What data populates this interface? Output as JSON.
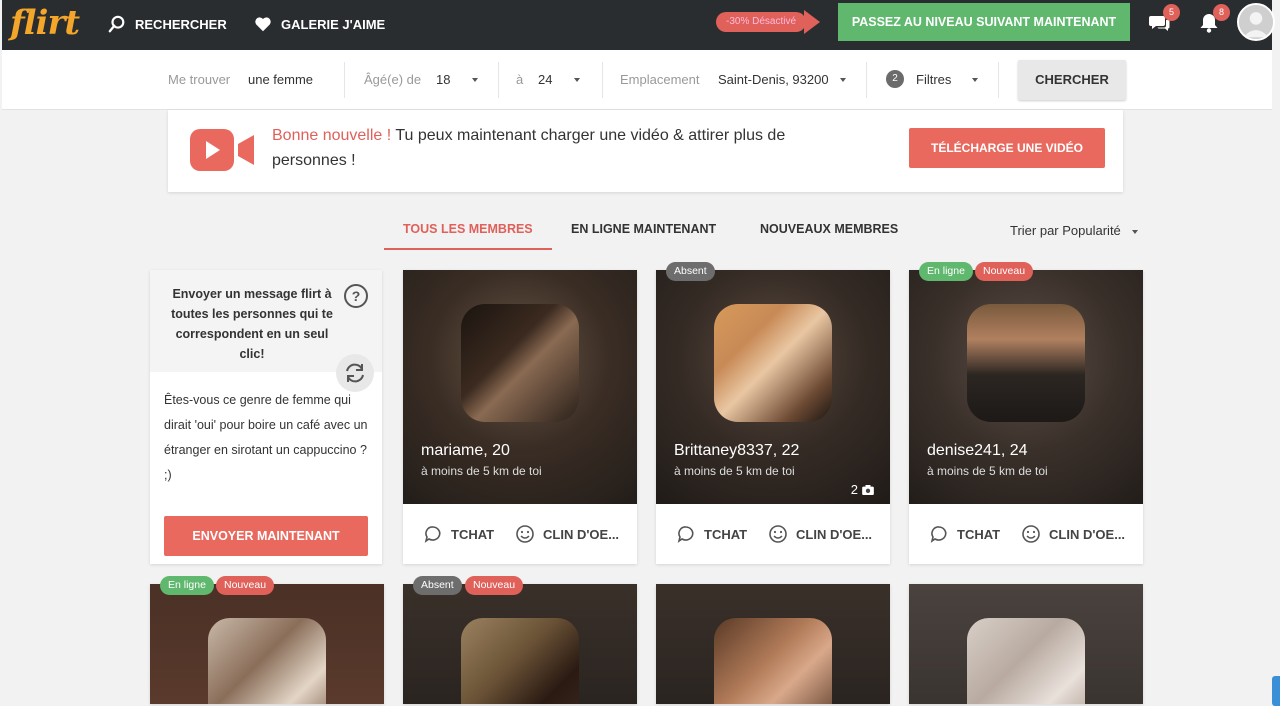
{
  "app": {
    "logo": "flirt"
  },
  "topnav": {
    "search_label": "RECHERCHER",
    "likes_label": "GALERIE J'AIME",
    "promo_label": "-30% Désactivé",
    "upgrade_label": "PASSEZ AU NIVEAU SUIVANT MAINTENANT",
    "messages_count": "5",
    "notifications_count": "8"
  },
  "searchbar": {
    "find_label": "Me trouver",
    "find_value": "une femme",
    "age_label": "Âgé(e) de",
    "age_min": "18",
    "age_to_label": "à",
    "age_max": "24",
    "location_label": "Emplacement",
    "location_value": "Saint-Denis, 93200",
    "filters_count": "2",
    "filters_label": "Filtres",
    "search_button": "CHERCHER"
  },
  "banner": {
    "highlight": "Bonne nouvelle !",
    "text": " Tu peux maintenant charger une vidéo & attirer plus de personnes !",
    "button": "TÉLÉCHARGE UNE VIDÉO"
  },
  "tabs": [
    {
      "label": "TOUS LES MEMBRES",
      "active": true
    },
    {
      "label": "EN LIGNE MAINTENANT",
      "active": false
    },
    {
      "label": "NOUVEAUX MEMBRES",
      "active": false
    }
  ],
  "sort_label": "Trier par Popularité",
  "message_card": {
    "title": "Envoyer un message flirt à toutes les personnes qui te correspondent en un seul clic!",
    "body": "Êtes-vous ce genre de femme qui dirait 'oui' pour boire un café avec un étranger en sirotant un cappuccino ? ;)",
    "button": "ENVOYER MAINTENANT"
  },
  "members": [
    {
      "name": "mariame",
      "age": ", 20",
      "distance": "à moins de 5 km de toi",
      "tags": [],
      "photo_count": ""
    },
    {
      "name": "Brittaney8337",
      "age": ", 22",
      "distance": "à moins de 5 km de toi",
      "tags": [
        "Absent"
      ],
      "photo_count": "2"
    },
    {
      "name": "denise241",
      "age": ", 24",
      "distance": "à moins de 5 km de toi",
      "tags": [
        "En ligne",
        "Nouveau"
      ],
      "photo_count": ""
    },
    {
      "tags": [
        "En ligne",
        "Nouveau"
      ]
    },
    {
      "tags": [
        "Absent",
        "Nouveau"
      ]
    },
    {
      "tags": []
    },
    {
      "tags": []
    }
  ],
  "actions": {
    "chat": "TCHAT",
    "wink": "CLIN D'OE..."
  }
}
